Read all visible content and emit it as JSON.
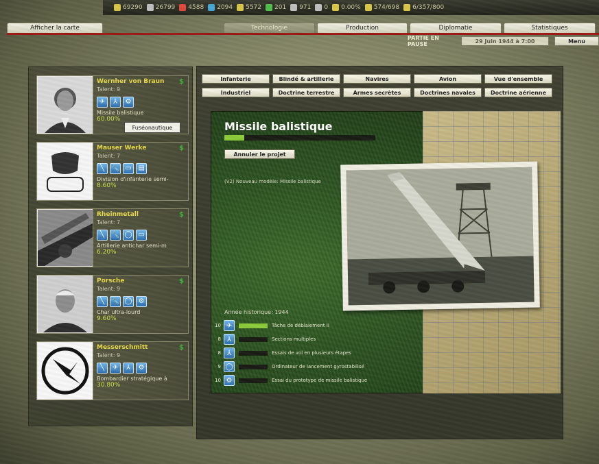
{
  "resources": [
    {
      "icon": "industry-icon",
      "value": "69290",
      "color": "#d8c64a"
    },
    {
      "icon": "supplies-icon",
      "value": "26799",
      "color": "#bfbfbf"
    },
    {
      "icon": "energy-icon",
      "value": "4588",
      "color": "#e04a3a"
    },
    {
      "icon": "oil-icon",
      "value": "2094",
      "color": "#48a8d8"
    },
    {
      "icon": "transport-icon",
      "value": "5572",
      "color": "#d8c64a"
    },
    {
      "icon": "money-icon",
      "value": "201",
      "color": "#4fc04a"
    },
    {
      "icon": "manpower-icon",
      "value": "971",
      "color": "#bfbfbf"
    },
    {
      "icon": "nuclear-icon",
      "value": "0",
      "color": "#bfbfbf"
    },
    {
      "icon": "dissent-icon",
      "value": "0.00%",
      "color": "#d8c64a"
    },
    {
      "icon": "convoy-icon",
      "value": "574/698",
      "color": "#d8c64a"
    },
    {
      "icon": "leadership-icon",
      "value": "6/357/800",
      "color": "#d8c64a"
    }
  ],
  "tabs": {
    "map": "Afficher la carte",
    "technology": "Technologie",
    "production": "Production",
    "diplomacy": "Diplomatie",
    "statistics": "Statistiques"
  },
  "status": {
    "paused": "PARTIE EN PAUSE",
    "date": "29 Juin 1944 à 7:00",
    "menu": "Menu"
  },
  "teams": [
    {
      "name": "Wernher von Braun",
      "talent": "Talent: 9",
      "project": "Missile balistique",
      "percent": "60.00%",
      "icons": [
        "rocket-icon",
        "propeller-icon",
        "gear-icon"
      ]
    },
    {
      "name": "Mauser Werke",
      "talent": "Talent: 7",
      "project": "Division d'infanterie semi-",
      "percent": "8.60%",
      "icons": [
        "rifle-icon",
        "wrench-icon",
        "blueprint-icon",
        "document-icon"
      ]
    },
    {
      "name": "Rheinmetall",
      "talent": "Talent: 7",
      "project": "Artillerie antichar semi-m",
      "percent": "6.20%",
      "icons": [
        "rifle-icon",
        "wrench-icon",
        "lightbulb-icon",
        "blueprint-icon"
      ]
    },
    {
      "name": "Porsche",
      "talent": "Talent: 9",
      "project": "Char ultra-lourd",
      "percent": "9.60%",
      "icons": [
        "rifle-icon",
        "wrench-icon",
        "lightbulb-icon",
        "gear-icon"
      ]
    },
    {
      "name": "Messerschmitt",
      "talent": "Talent: 9",
      "project": "Bombardier stratégique à",
      "percent": "30.80%",
      "icons": [
        "rifle-icon",
        "rocket-icon",
        "propeller-icon",
        "gear-icon"
      ]
    }
  ],
  "tooltip": "Fuséonautique",
  "category_tabs": {
    "row1": [
      "Infanterie",
      "Blindé & artillerie",
      "Navires",
      "Avion",
      "Vue d'ensemble"
    ],
    "row2": [
      "Industriel",
      "Doctrine terrestre",
      "Armes secrètes",
      "Doctrines navales",
      "Doctrine aérienne"
    ]
  },
  "detail": {
    "title": "Missile balistique",
    "progress": 0.13,
    "cancel": "Annuler le projet",
    "description": "(V2) Nouveau modèle: Missile balistique",
    "year": "Année historique: 1944"
  },
  "requirements": [
    {
      "level": "10",
      "icon": "rocket-icon",
      "progress": 1.0,
      "label": "Tâche de déblaiement II"
    },
    {
      "level": "8",
      "icon": "propeller-icon",
      "progress": 0.0,
      "label": "Sections multiples"
    },
    {
      "level": "8",
      "icon": "propeller-icon",
      "progress": 0.0,
      "label": "Essais de vol en plusieurs étapes"
    },
    {
      "level": "9",
      "icon": "lightbulb-icon",
      "progress": 0.0,
      "label": "Ordinateur de lancement gyrostabilisé"
    },
    {
      "level": "10",
      "icon": "gear-icon",
      "progress": 0.0,
      "label": "Essai du prototype de missile balistique"
    }
  ],
  "colors": {
    "accent_yellow": "#e8d94a",
    "progress_green": "#8dcb3a",
    "icon_blue": "#2e6fae"
  }
}
